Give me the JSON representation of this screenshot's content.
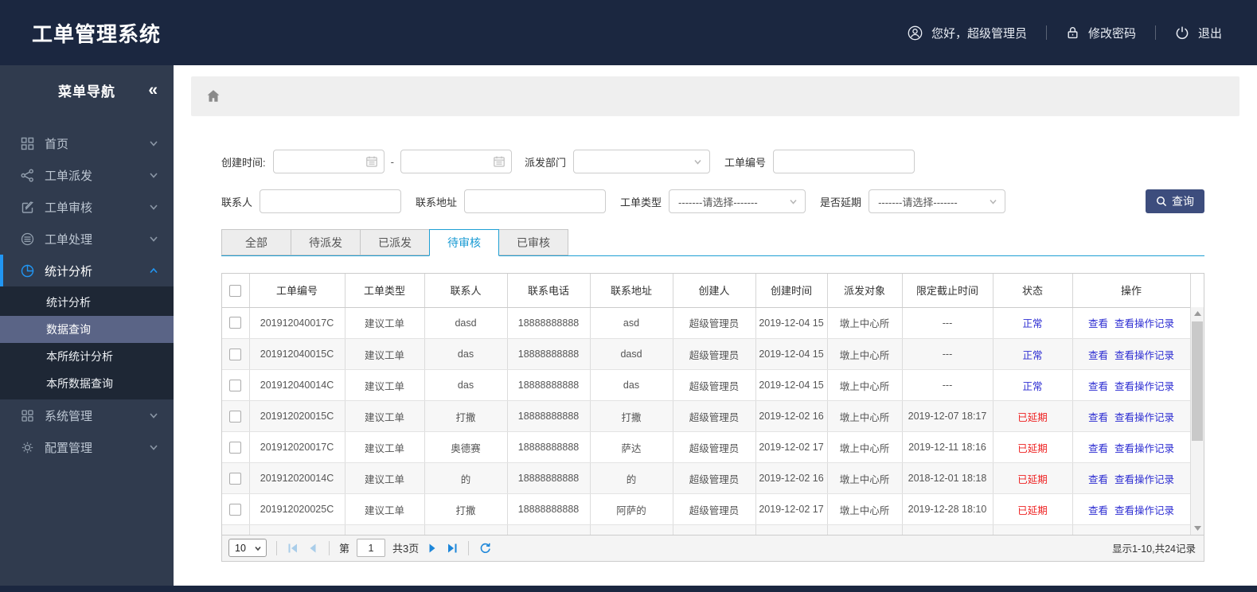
{
  "header": {
    "title": "工单管理系统",
    "greeting": "您好，超级管理员",
    "change_password": "修改密码",
    "logout": "退出"
  },
  "sidebar": {
    "title": "菜单导航",
    "collapse_glyph": "«",
    "items": [
      {
        "label": "首页",
        "icon": "grid"
      },
      {
        "label": "工单派发",
        "icon": "share-nodes"
      },
      {
        "label": "工单审核",
        "icon": "edit-square"
      },
      {
        "label": "工单处理",
        "icon": "stack-circle"
      },
      {
        "label": "统计分析",
        "icon": "pie-chart",
        "active": true,
        "expanded": true
      },
      {
        "label": "系统管理",
        "icon": "grid-outline"
      },
      {
        "label": "配置管理",
        "icon": "gear"
      }
    ],
    "submenu": [
      {
        "label": "统计分析"
      },
      {
        "label": "数据查询",
        "selected": true
      },
      {
        "label": "本所统计分析"
      },
      {
        "label": "本所数据查询"
      }
    ]
  },
  "search": {
    "created_time_label": "创建时间:",
    "range_separator": "-",
    "dispatch_dept_label": "派发部门",
    "order_no_label": "工单编号",
    "contact_label": "联系人",
    "address_label": "联系地址",
    "order_type_label": "工单类型",
    "delay_label": "是否延期",
    "select_placeholder": "-------请选择-------",
    "query_label": "查询"
  },
  "tabs": [
    {
      "label": "全部"
    },
    {
      "label": "待派发"
    },
    {
      "label": "已派发"
    },
    {
      "label": "待审核",
      "active": true
    },
    {
      "label": "已审核"
    }
  ],
  "table": {
    "columns": [
      "工单编号",
      "工单类型",
      "联系人",
      "联系电话",
      "联系地址",
      "创建人",
      "创建时间",
      "派发对象",
      "限定截止时间",
      "状态",
      "操作"
    ],
    "action_view": "查看",
    "action_log": "查看操作记录",
    "rows": [
      {
        "order_no": "201912040017C",
        "type": "建议工单",
        "contact": "dasd",
        "phone": "18888888888",
        "address": "asd",
        "creator": "超级管理员",
        "created": "2019-12-04 15",
        "target": "墩上中心所",
        "deadline": "---",
        "status": "正常",
        "status_type": "normal"
      },
      {
        "order_no": "201912040015C",
        "type": "建议工单",
        "contact": "das",
        "phone": "18888888888",
        "address": "dasd",
        "creator": "超级管理员",
        "created": "2019-12-04 15",
        "target": "墩上中心所",
        "deadline": "---",
        "status": "正常",
        "status_type": "normal"
      },
      {
        "order_no": "201912040014C",
        "type": "建议工单",
        "contact": "das",
        "phone": "18888888888",
        "address": "das",
        "creator": "超级管理员",
        "created": "2019-12-04 15",
        "target": "墩上中心所",
        "deadline": "---",
        "status": "正常",
        "status_type": "normal"
      },
      {
        "order_no": "201912020015C",
        "type": "建议工单",
        "contact": "打撒",
        "phone": "18888888888",
        "address": "打撒",
        "creator": "超级管理员",
        "created": "2019-12-02 16",
        "target": "墩上中心所",
        "deadline": "2019-12-07 18:17",
        "status": "已延期",
        "status_type": "delayed"
      },
      {
        "order_no": "201912020017C",
        "type": "建议工单",
        "contact": "奥德赛",
        "phone": "18888888888",
        "address": "萨达",
        "creator": "超级管理员",
        "created": "2019-12-02 17",
        "target": "墩上中心所",
        "deadline": "2019-12-11 18:16",
        "status": "已延期",
        "status_type": "delayed"
      },
      {
        "order_no": "201912020014C",
        "type": "建议工单",
        "contact": "的",
        "phone": "18888888888",
        "address": "的",
        "creator": "超级管理员",
        "created": "2019-12-02 16",
        "target": "墩上中心所",
        "deadline": "2018-12-01 18:18",
        "status": "已延期",
        "status_type": "delayed"
      },
      {
        "order_no": "201912020025C",
        "type": "建议工单",
        "contact": "打撒",
        "phone": "18888888888",
        "address": "阿萨的",
        "creator": "超级管理员",
        "created": "2019-12-02 17",
        "target": "墩上中心所",
        "deadline": "2019-12-28 18:10",
        "status": "已延期",
        "status_type": "delayed"
      }
    ]
  },
  "pagination": {
    "page_size": "10",
    "page_label_prefix": "第",
    "current_page": "1",
    "total_pages_label": "共3页",
    "summary": "显示1-10,共24记录"
  },
  "colors": {
    "header_bg": "#1b2740",
    "sidebar_bg": "#303b4e",
    "submenu_bg": "#1e2735",
    "submenu_selected": "#5a6486",
    "accent_blue": "#2196f3",
    "query_btn": "#3d4d7d",
    "tab_active": "#189ad3",
    "tab_border": "#1e9fd4",
    "link_blue": "#2d2dd2",
    "status_normal": "#2d2dd2",
    "status_delayed": "#ee2222",
    "pager_blue": "#1c86d9",
    "pager_disabled": "#a9cde9"
  }
}
